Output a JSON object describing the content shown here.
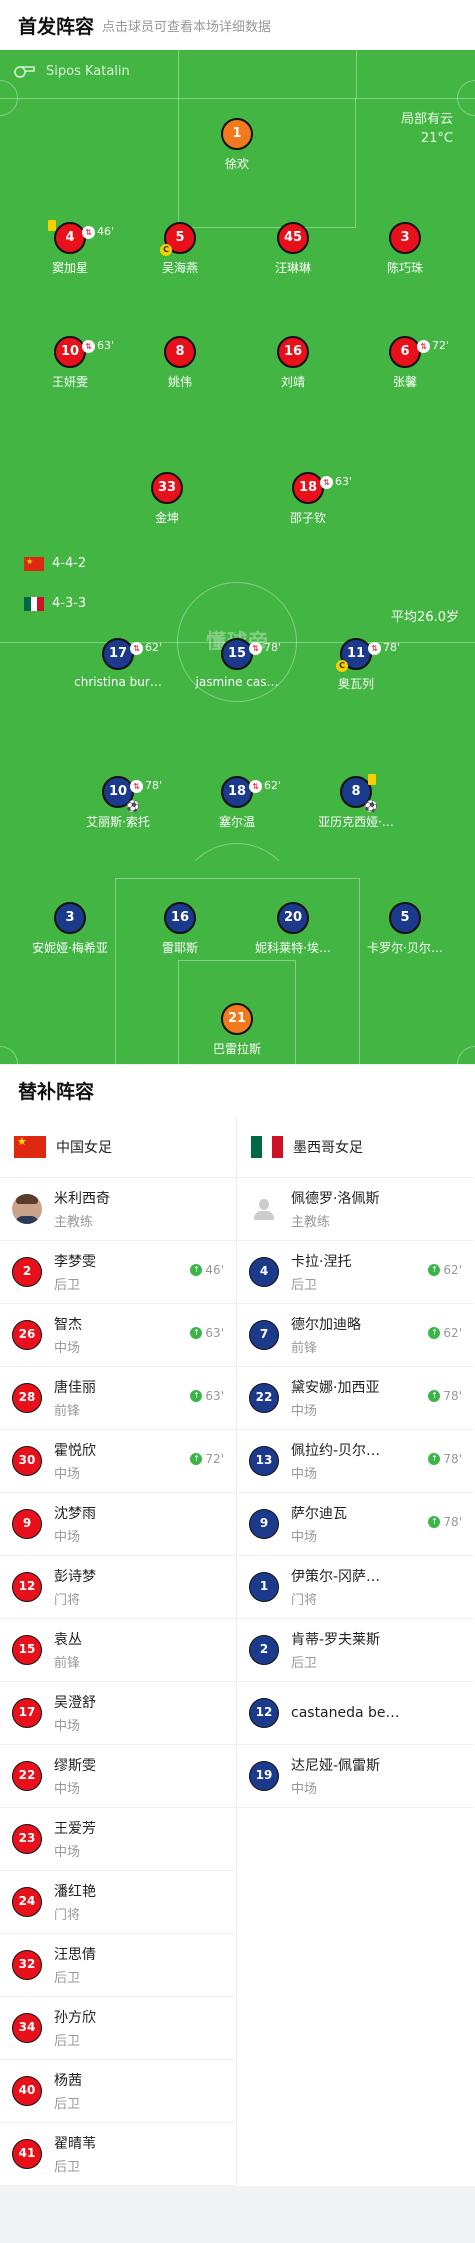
{
  "header": {
    "title": "首发阵容",
    "subtitle": "点击球员可查看本场详细数据"
  },
  "pitch": {
    "referee": "Sipos Katalin",
    "weather": "局部有云",
    "temperature": "21°C",
    "watermark": "懂球帝",
    "home": {
      "formation": "4-4-2",
      "avg_age": "平均26.0岁"
    },
    "away": {
      "formation": "4-3-3"
    }
  },
  "home_players": [
    {
      "num": "1",
      "name": "徐欢",
      "color": "orange"
    },
    {
      "num": "4",
      "name": "窦加星",
      "sub_time": "46'",
      "yellow": true
    },
    {
      "num": "5",
      "name": "吴海燕",
      "captain": true
    },
    {
      "num": "45",
      "name": "汪琳琳"
    },
    {
      "num": "3",
      "name": "陈巧珠"
    },
    {
      "num": "10",
      "name": "王妍雯",
      "sub_time": "63'"
    },
    {
      "num": "8",
      "name": "姚伟"
    },
    {
      "num": "16",
      "name": "刘靖"
    },
    {
      "num": "6",
      "name": "张馨",
      "sub_time": "72'"
    },
    {
      "num": "33",
      "name": "金坤"
    },
    {
      "num": "18",
      "name": "邵子钦",
      "sub_time": "63'"
    }
  ],
  "away_players": [
    {
      "num": "17",
      "name": "christina bur…",
      "sub_time": "62'"
    },
    {
      "num": "15",
      "name": "jasmine cas…",
      "sub_time": "78'"
    },
    {
      "num": "11",
      "name": "奥瓦列",
      "sub_time": "78'",
      "captain": true
    },
    {
      "num": "10",
      "name": "艾丽斯·索托",
      "sub_time": "78'",
      "goal": true
    },
    {
      "num": "18",
      "name": "塞尔温",
      "sub_time": "62'"
    },
    {
      "num": "8",
      "name": "亚历克西娅·…",
      "yellow": true,
      "goal": true
    },
    {
      "num": "3",
      "name": "安妮娅·梅希亚"
    },
    {
      "num": "16",
      "name": "雷耶斯"
    },
    {
      "num": "20",
      "name": "妮科莱特·埃…"
    },
    {
      "num": "5",
      "name": "卡罗尔·贝尔…"
    },
    {
      "num": "21",
      "name": "巴雷拉斯",
      "color": "orange"
    }
  ],
  "subs": {
    "title": "替补阵容",
    "home": {
      "team": "中国女足",
      "coach": {
        "name": "米利西奇",
        "role": "主教练"
      },
      "players": [
        {
          "num": "2",
          "name": "李梦雯",
          "pos": "后卫",
          "time": "46'"
        },
        {
          "num": "26",
          "name": "智杰",
          "pos": "中场",
          "time": "63'"
        },
        {
          "num": "28",
          "name": "唐佳丽",
          "pos": "前锋",
          "time": "63'"
        },
        {
          "num": "30",
          "name": "霍悦欣",
          "pos": "中场",
          "time": "72'"
        },
        {
          "num": "9",
          "name": "沈梦雨",
          "pos": "中场"
        },
        {
          "num": "12",
          "name": "彭诗梦",
          "pos": "门将"
        },
        {
          "num": "15",
          "name": "袁丛",
          "pos": "前锋"
        },
        {
          "num": "17",
          "name": "吴澄舒",
          "pos": "中场"
        },
        {
          "num": "22",
          "name": "缪斯雯",
          "pos": "中场"
        },
        {
          "num": "23",
          "name": "王爱芳",
          "pos": "中场"
        },
        {
          "num": "24",
          "name": "潘红艳",
          "pos": "门将"
        },
        {
          "num": "32",
          "name": "汪思倩",
          "pos": "后卫"
        },
        {
          "num": "34",
          "name": "孙方欣",
          "pos": "后卫"
        },
        {
          "num": "40",
          "name": "杨茜",
          "pos": "后卫"
        },
        {
          "num": "41",
          "name": "翟晴苇",
          "pos": "后卫"
        }
      ]
    },
    "away": {
      "team": "墨西哥女足",
      "coach": {
        "name": "佩德罗·洛佩斯",
        "role": "主教练"
      },
      "players": [
        {
          "num": "4",
          "name": "卡拉·涅托",
          "pos": "后卫",
          "time": "62'"
        },
        {
          "num": "7",
          "name": "德尔加迪略",
          "pos": "前锋",
          "time": "62'"
        },
        {
          "num": "22",
          "name": "黛安娜·加西亚",
          "pos": "中场",
          "time": "78'"
        },
        {
          "num": "13",
          "name": "佩拉约-贝尔…",
          "pos": "中场",
          "time": "78'"
        },
        {
          "num": "9",
          "name": "萨尔迪瓦",
          "pos": "中场",
          "time": "78'"
        },
        {
          "num": "1",
          "name": "伊策尔-冈萨…",
          "pos": "门将"
        },
        {
          "num": "2",
          "name": "肯蒂-罗夫莱斯",
          "pos": "后卫"
        },
        {
          "num": "12",
          "name": "castaneda be…",
          "pos": ""
        },
        {
          "num": "19",
          "name": "达尼娅-佩雷斯",
          "pos": "中场"
        }
      ]
    }
  },
  "colors": {
    "pitch": "#43b543",
    "home": "#e8101b",
    "away": "#1b3a8b",
    "keeper": "#f07a1d",
    "sub_in": "#3bb54a"
  }
}
